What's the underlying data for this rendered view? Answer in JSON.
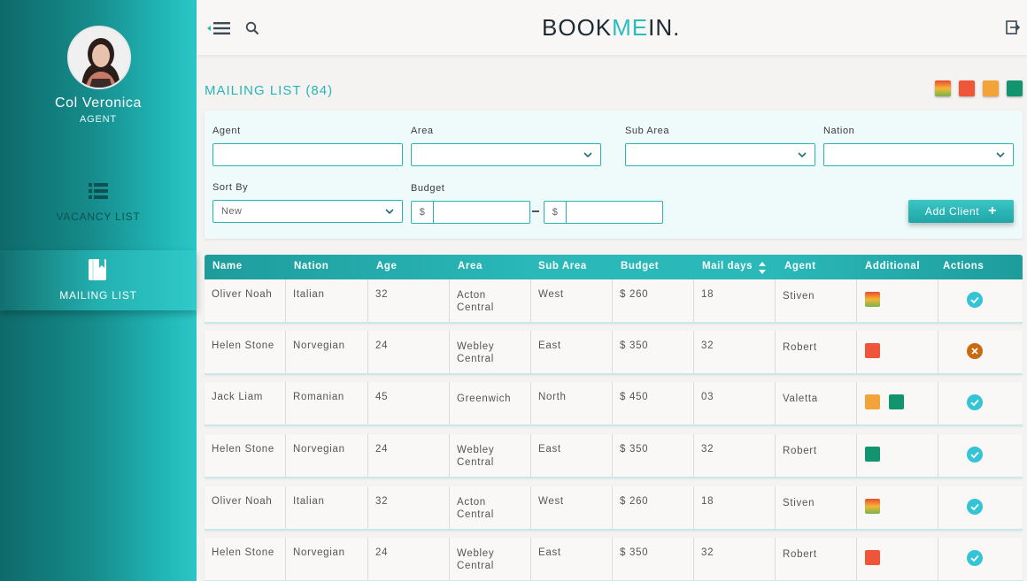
{
  "user": {
    "name": "Col Veronica",
    "role": "AGENT"
  },
  "sidebar": {
    "items": [
      {
        "label": "VACANCY LIST",
        "icon": "list-icon"
      },
      {
        "label": "MAILING LIST",
        "icon": "book-icon",
        "active": true
      }
    ]
  },
  "header": {
    "logo_pre": "BOOK",
    "logo_mid": "ME",
    "logo_post": "IN."
  },
  "page": {
    "title": "MAILING LIST (84)"
  },
  "legend": [
    {
      "name": "gradient",
      "color": "#e8c23a"
    },
    {
      "name": "red",
      "color": "#ef5538"
    },
    {
      "name": "orange",
      "color": "#f2a43a"
    },
    {
      "name": "green",
      "color": "#12946e"
    }
  ],
  "filters": {
    "agent_label": "Agent",
    "agent_value": "",
    "area_label": "Area",
    "area_value": "",
    "subarea_label": "Sub Area",
    "subarea_value": "",
    "nation_label": "Nation",
    "nation_value": "",
    "sortby_label": "Sort By",
    "sortby_value": "New",
    "budget_label": "Budget",
    "budget_currency": "$",
    "add_client_label": "Add Client"
  },
  "table": {
    "columns": [
      "Name",
      "Nation",
      "Age",
      "Area",
      "Sub Area",
      "Budget",
      "Mail days",
      "Agent",
      "Additional",
      "Actions"
    ],
    "rows": [
      {
        "name": "Oliver Noah",
        "nation": "Italian",
        "age": "32",
        "area1": "Acton",
        "area2": "Central",
        "subarea": "West",
        "budget": "$ 260",
        "maildays": "18",
        "agent": "Stiven",
        "additional": [
          "gradient"
        ],
        "action": "check"
      },
      {
        "name": "Helen Stone",
        "nation": "Norvegian",
        "age": "24",
        "area1": "Webley",
        "area2": "Central",
        "subarea": "East",
        "budget": "$ 350",
        "maildays": "32",
        "agent": "Robert",
        "additional": [
          "red"
        ],
        "action": "cancel"
      },
      {
        "name": "Jack Liam",
        "nation": "Romanian",
        "age": "45",
        "area1": "Greenwich",
        "area2": "",
        "subarea": "North",
        "budget": "$ 450",
        "maildays": "03",
        "agent": "Valetta",
        "additional": [
          "orange",
          "green"
        ],
        "action": "check"
      },
      {
        "name": "Helen Stone",
        "nation": "Norvegian",
        "age": "24",
        "area1": "Webley",
        "area2": "Central",
        "subarea": "East",
        "budget": "$ 350",
        "maildays": "32",
        "agent": "Robert",
        "additional": [
          "green"
        ],
        "action": "check"
      },
      {
        "name": "Oliver Noah",
        "nation": "Italian",
        "age": "32",
        "area1": "Acton",
        "area2": "Central",
        "subarea": "West",
        "budget": "$ 260",
        "maildays": "18",
        "agent": "Stiven",
        "additional": [
          "gradient"
        ],
        "action": "check"
      },
      {
        "name": "Helen Stone",
        "nation": "Norvegian",
        "age": "24",
        "area1": "Webley",
        "area2": "Central",
        "subarea": "East",
        "budget": "$ 350",
        "maildays": "32",
        "agent": "Robert",
        "additional": [
          "red"
        ],
        "action": "check"
      }
    ]
  }
}
